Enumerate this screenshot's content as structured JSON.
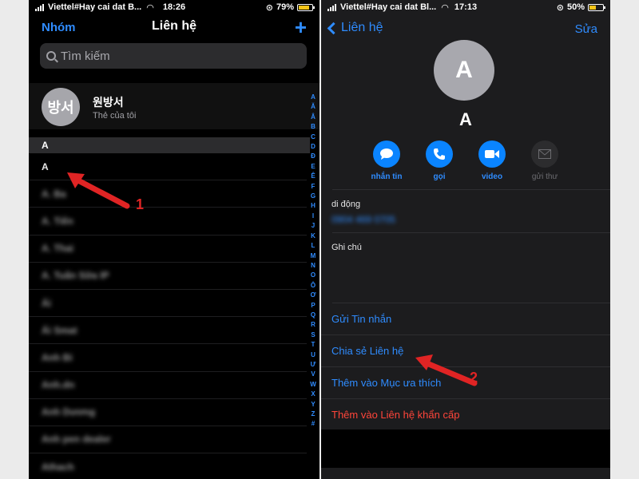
{
  "left_phone": {
    "status": {
      "carrier": "Viettel#Hay cai dat B...",
      "time": "18:26",
      "battery": "79%",
      "battery_level": 0.79
    },
    "nav": {
      "left_label": "Nhóm",
      "title": "Liên hệ",
      "add_label": "+"
    },
    "search": {
      "placeholder": "Tìm kiếm"
    },
    "my_card": {
      "avatar_text": "방서",
      "name": "원방서",
      "subtitle": "Thẻ của tôi"
    },
    "section_header": "A",
    "contacts": [
      "A",
      "A. Ba",
      "A. Tiến",
      "A. Thai",
      "A. Tuấn Sữa IP",
      "Ái",
      "Ái Smat",
      "Anh Bi",
      "Anh.dn",
      "Anh Dương",
      "Anh pen dealer",
      "Athach"
    ],
    "index_letters": [
      "A",
      "Ă",
      "Â",
      "B",
      "C",
      "D",
      "Đ",
      "E",
      "Ê",
      "F",
      "G",
      "H",
      "I",
      "J",
      "K",
      "L",
      "M",
      "N",
      "O",
      "Ô",
      "Ơ",
      "P",
      "Q",
      "R",
      "S",
      "T",
      "U",
      "Ư",
      "V",
      "W",
      "X",
      "Y",
      "Z",
      "#"
    ],
    "annotation_number": "1"
  },
  "right_phone": {
    "status": {
      "carrier": "Viettel#Hay cai dat Bl...",
      "time": "17:13",
      "battery": "50%",
      "battery_level": 0.5
    },
    "nav": {
      "back_label": "Liên hệ",
      "edit_label": "Sửa"
    },
    "contact": {
      "avatar_text": "A",
      "name": "A"
    },
    "actions": [
      {
        "label": "nhắn tin",
        "icon": "message-icon",
        "enabled": true
      },
      {
        "label": "gọi",
        "icon": "phone-icon",
        "enabled": true
      },
      {
        "label": "video",
        "icon": "video-icon",
        "enabled": true
      },
      {
        "label": "gửi thư",
        "icon": "mail-icon",
        "enabled": false
      }
    ],
    "mobile": {
      "label": "di động",
      "value": "0904 469 0705"
    },
    "notes": {
      "label": "Ghi chú"
    },
    "links": {
      "send_message": "Gửi Tin nhắn",
      "share_contact": "Chia sẻ Liên hệ",
      "add_favorites": "Thêm vào Mục ưa thích",
      "add_emergency": "Thêm vào Liên hệ khẩn cấp"
    },
    "annotation_number": "2"
  },
  "colors": {
    "accent": "#2f8cff",
    "danger": "#ff453a",
    "annotation": "#e02424",
    "battery": "#f5c518"
  }
}
